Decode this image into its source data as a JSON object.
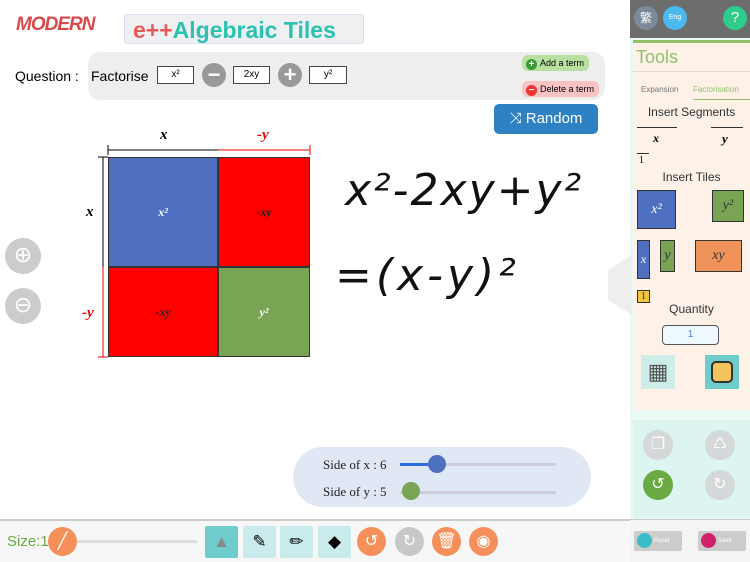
{
  "header": {
    "logo": "MODERN",
    "title_prefix": "e++",
    "title": "Algebraic Tiles"
  },
  "question": {
    "label": "Question :",
    "verb": "Factorise",
    "terms": [
      "x²",
      "2xy",
      "y²"
    ],
    "ops": [
      "minus",
      "plus"
    ],
    "add_term": "Add a term",
    "delete_term": "Delete a term",
    "random": "Random"
  },
  "grid": {
    "top_labels": [
      "x",
      "-y"
    ],
    "left_labels": [
      "x",
      "-y"
    ],
    "tiles": [
      [
        "x²",
        "-xy"
      ],
      [
        "-xy",
        "y²"
      ]
    ]
  },
  "handwriting": {
    "line1": "x²-2xy+y²",
    "line2": "=(x-y)²"
  },
  "sliders": {
    "x": {
      "label": "Side of x : 6",
      "value": 6
    },
    "y": {
      "label": "Side of y : 5",
      "value": 5
    }
  },
  "bottom": {
    "size_label": "Size:1",
    "size": 1
  },
  "sidebar": {
    "lang_trad": "繁",
    "lang_eng": "Eng",
    "help": "?",
    "tools_title": "Tools",
    "tabs": [
      "Expansion",
      "Factorisation"
    ],
    "active_tab": "Factorisation",
    "insert_segments": "Insert Segments",
    "segments": [
      "x",
      "y",
      "1"
    ],
    "insert_tiles": "Insert Tiles",
    "tiles": [
      "x²",
      "y²",
      "x",
      "y",
      "xy",
      "1"
    ],
    "quantity_label": "Quantity",
    "quantity": "1",
    "reset": "Reset",
    "save": "Save"
  },
  "colors": {
    "x2": "#4f70c0",
    "y2": "#78a453",
    "neg": "#ff0000",
    "xy": "#f0935a",
    "accent": "#2e82c4",
    "green": "#6aaa42"
  }
}
